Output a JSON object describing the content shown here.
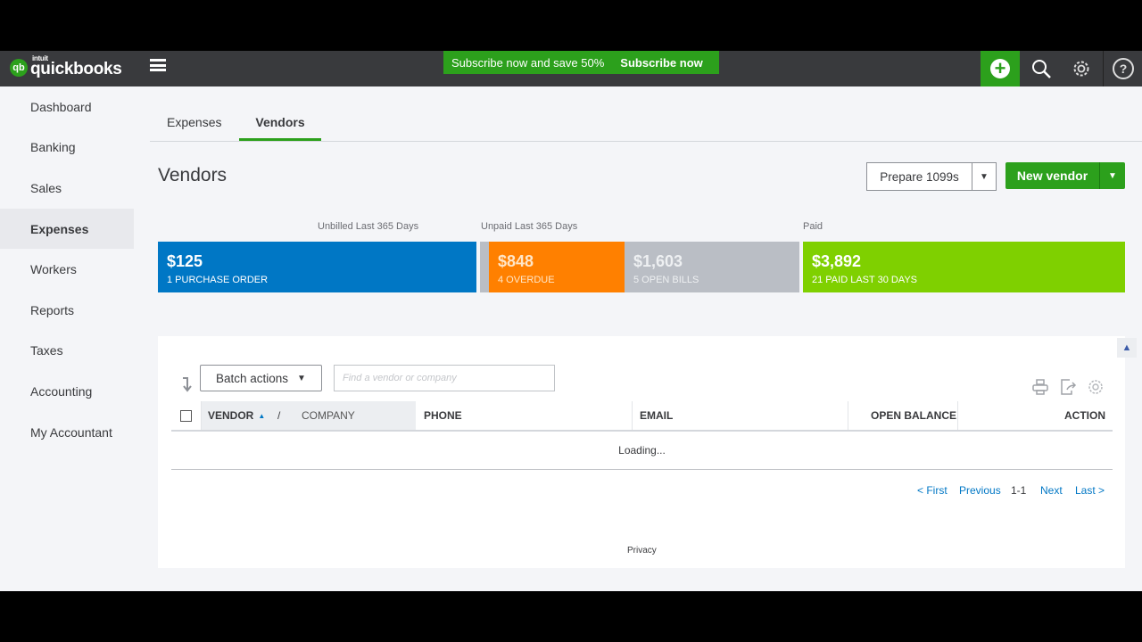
{
  "header": {
    "brand_small": "intuit",
    "brand": "quickbooks",
    "logo_mark": "qb",
    "promo_text": "Subscribe now and save 50%",
    "promo_button": "Subscribe now",
    "icons": [
      "plus-icon",
      "search-icon",
      "gear-icon",
      "help-icon"
    ]
  },
  "sidebar": {
    "items": [
      {
        "label": "Dashboard"
      },
      {
        "label": "Banking"
      },
      {
        "label": "Sales"
      },
      {
        "label": "Expenses",
        "active": true
      },
      {
        "label": "Workers"
      },
      {
        "label": "Reports"
      },
      {
        "label": "Taxes"
      },
      {
        "label": "Accounting"
      },
      {
        "label": "My Accountant"
      }
    ]
  },
  "tabs": [
    {
      "label": "Expenses"
    },
    {
      "label": "Vendors",
      "active": true
    }
  ],
  "page": {
    "title": "Vendors",
    "prepare_button": "Prepare 1099s",
    "new_vendor_button": "New vendor"
  },
  "summary": {
    "labels": {
      "unbilled": "Unbilled Last 365 Days",
      "unpaid": "Unpaid Last 365 Days",
      "paid": "Paid"
    },
    "cards": [
      {
        "value": "$125",
        "sub": "1 PURCHASE ORDER",
        "color": "#0077c5"
      },
      {
        "value": "$848",
        "sub": "4 OVERDUE",
        "color": "#ff8000"
      },
      {
        "value": "$1,603",
        "sub": "5 OPEN BILLS",
        "color": "#babec5"
      },
      {
        "value": "$3,892",
        "sub": "21 PAID LAST 30 DAYS",
        "color": "#7fd000"
      }
    ]
  },
  "table": {
    "batch_actions": "Batch actions",
    "search_placeholder": "Find a vendor or company",
    "columns": {
      "vendor": "VENDOR",
      "sep": "/",
      "company": "COMPANY",
      "phone": "PHONE",
      "email": "EMAIL",
      "balance": "OPEN BALANCE",
      "action": "ACTION"
    },
    "loading": "Loading...",
    "pager": {
      "first": "< First",
      "previous": "Previous",
      "range": "1-1",
      "next": "Next",
      "last": "Last >"
    }
  },
  "footer": {
    "privacy": "Privacy"
  }
}
